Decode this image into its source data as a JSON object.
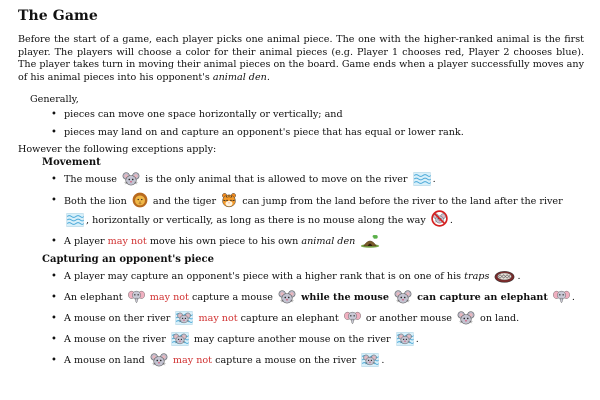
{
  "title": "The Game",
  "intro": "Before the start of a game, each player picks one animal piece. The one with the higher-ranked animal is the first player. The players will choose a color for their animal pieces (e.g. Player 1 chooses red, Player 2 chooses blue). The player takes turn in moving their animal pieces on the board. Game ends when a player successfully moves any of his animal pieces into his opponent's ",
  "intro_em": "animal den",
  "intro_end": ".",
  "generally": "Generally,",
  "general_rules": [
    "pieces can move one space horizontally or vertically; and",
    "pieces may land on and capture an opponent's piece that has equal or lower rank."
  ],
  "however": "However the following exceptions apply:",
  "movement": {
    "heading": "Movement",
    "r1": {
      "a": "The mouse",
      "b": "is the only animal that is allowed to move on the river",
      "c": "."
    },
    "r2": {
      "a": "Both the lion",
      "b": "and the tiger",
      "c": "can jump from the land before the river to the land after the river",
      "d": ", horizontally or vertically, as long as there is no mouse along the way",
      "e": "."
    },
    "r3": {
      "a": "A player",
      "red": "may not",
      "b": "move his own piece to his own",
      "em": "animal den"
    }
  },
  "capturing": {
    "heading": "Capturing an opponent's piece",
    "r1": {
      "a": "A player may capture an opponent's piece with a higher rank that is on one of his",
      "em": "traps",
      "b": "."
    },
    "r2": {
      "a": "An elephant",
      "red": "may not",
      "b": "capture a mouse",
      "c": "while the mouse",
      "d": "can capture an elephant",
      "e": "."
    },
    "r3": {
      "a": "A mouse on ther river",
      "red": "may not",
      "b": "capture an elephant",
      "c": "or another mouse",
      "d": "on land."
    },
    "r4": {
      "a": "A mouse on the river",
      "b": "may capture another mouse on the river",
      "c": "."
    },
    "r5": {
      "a": "A mouse on land",
      "red": "may not",
      "b": "capture a mouse on the river",
      "c": "."
    }
  },
  "icons": {
    "mouse": "mouse-icon",
    "river": "river-icon",
    "lion": "lion-icon",
    "tiger": "tiger-icon",
    "no_mouse": "no-mouse-icon",
    "den": "animal-den-icon",
    "trap": "trap-icon",
    "elephant": "elephant-icon",
    "mouse_in_river": "mouse-in-river-icon"
  },
  "colors": {
    "accent_red": "#d03030"
  }
}
